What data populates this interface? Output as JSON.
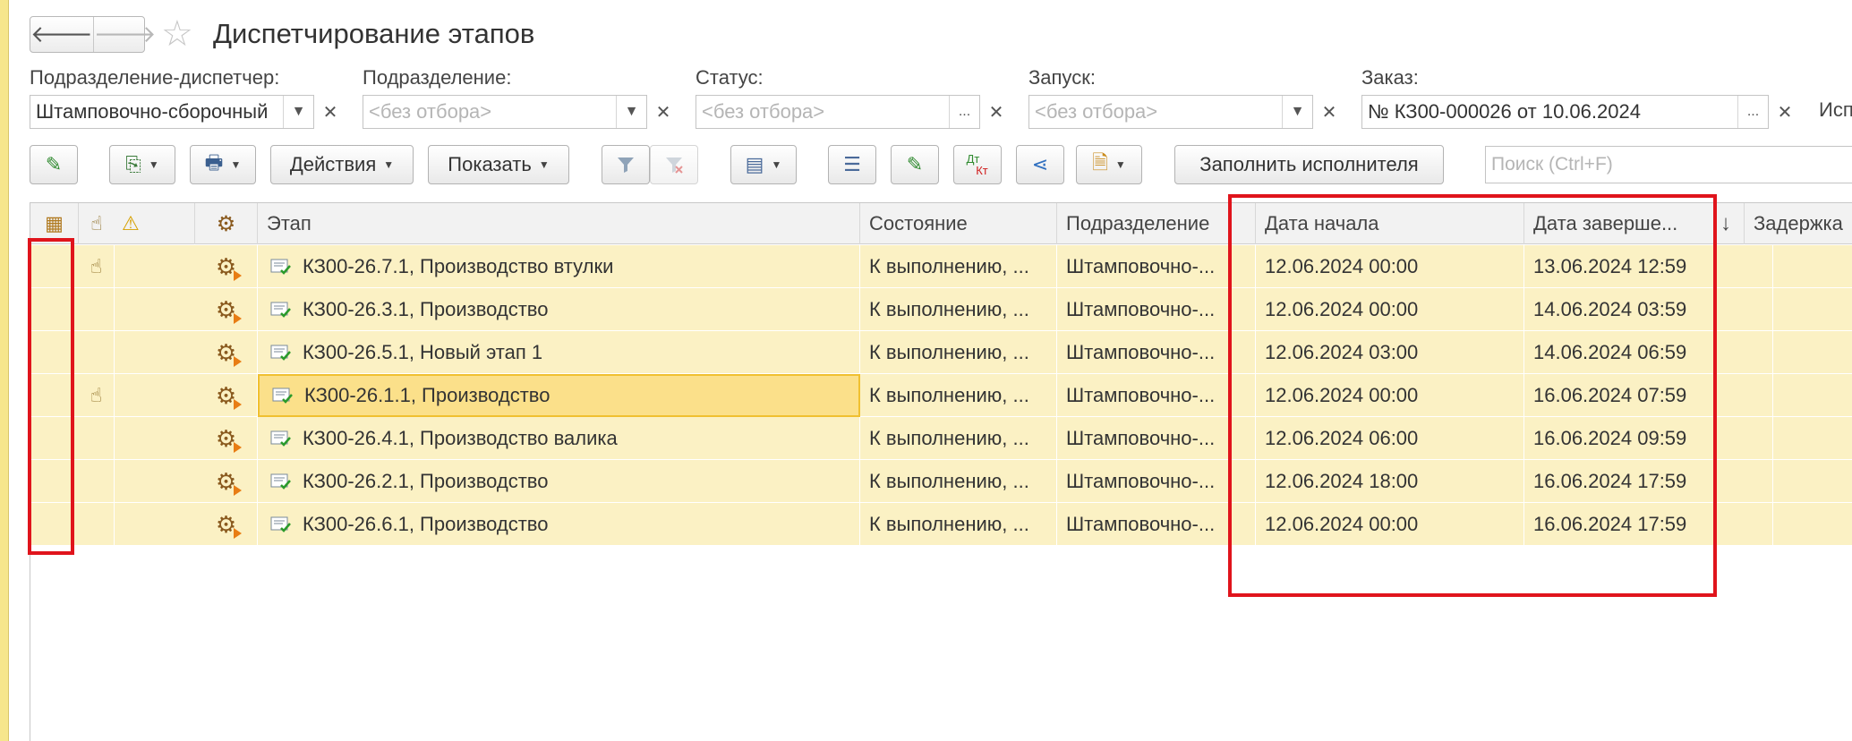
{
  "window": {
    "title": "Диспетчирование этапов"
  },
  "filters": [
    {
      "label": "Подразделение-диспетчер:",
      "value": "Штамповочно-сборочный",
      "placeholder": ""
    },
    {
      "label": "Подразделение:",
      "value": "",
      "placeholder": "<без отбора>"
    },
    {
      "label": "Статус:",
      "value": "",
      "placeholder": "<без отбора>"
    },
    {
      "label": "Запуск:",
      "value": "",
      "placeholder": "<без отбора>"
    },
    {
      "label": "Заказ:",
      "value": "№ КЗ00-000026 от 10.06.2024",
      "placeholder": ""
    }
  ],
  "cut_label": "Исп",
  "toolbar": {
    "actions_label": "Действия",
    "show_label": "Показать",
    "fill_executor_label": "Заполнить исполнителя",
    "dt_label": "Дт",
    "kt_label": "Кт"
  },
  "search": {
    "placeholder": "Поиск (Ctrl+F)"
  },
  "table": {
    "columns": [
      "Этап",
      "Состояние",
      "Подразделение",
      "Дата начала",
      "Дата заверше...",
      "Задержка"
    ],
    "sort_indicator": "↓",
    "rows": [
      {
        "etap": "КЗ00-26.7.1, Производство втулки",
        "state": "К выполнению, ...",
        "dept": "Штамповочно-...",
        "start": "12.06.2024 00:00",
        "end": "13.06.2024 12:59",
        "delay": "",
        "hand_icon": true
      },
      {
        "etap": "КЗ00-26.3.1, Производство",
        "state": "К выполнению, ...",
        "dept": "Штамповочно-...",
        "start": "12.06.2024 00:00",
        "end": "14.06.2024 03:59",
        "delay": "",
        "hand_icon": false
      },
      {
        "etap": "КЗ00-26.5.1, Новый этап 1",
        "state": "К выполнению, ...",
        "dept": "Штамповочно-...",
        "start": "12.06.2024 03:00",
        "end": "14.06.2024 06:59",
        "delay": "",
        "hand_icon": false
      },
      {
        "etap": "КЗ00-26.1.1, Производство",
        "state": "К выполнению, ...",
        "dept": "Штамповочно-...",
        "start": "12.06.2024 00:00",
        "end": "16.06.2024 07:59",
        "delay": "",
        "hand_icon": true,
        "selected": true
      },
      {
        "etap": "КЗ00-26.4.1, Производство валика",
        "state": "К выполнению, ...",
        "dept": "Штамповочно-...",
        "start": "12.06.2024 06:00",
        "end": "16.06.2024 09:59",
        "delay": "",
        "hand_icon": false
      },
      {
        "etap": "КЗ00-26.2.1, Производство",
        "state": "К выполнению, ...",
        "dept": "Штамповочно-...",
        "start": "12.06.2024 18:00",
        "end": "16.06.2024 17:59",
        "delay": "",
        "hand_icon": false
      },
      {
        "etap": "КЗ00-26.6.1, Производство",
        "state": "К выполнению, ...",
        "dept": "Штамповочно-...",
        "start": "12.06.2024 00:00",
        "end": "16.06.2024 17:59",
        "delay": "",
        "hand_icon": false
      }
    ]
  },
  "colors": {
    "row_bg": "#fbf1c4",
    "selection": "#fbe08a",
    "highlight": "#e0141c"
  }
}
